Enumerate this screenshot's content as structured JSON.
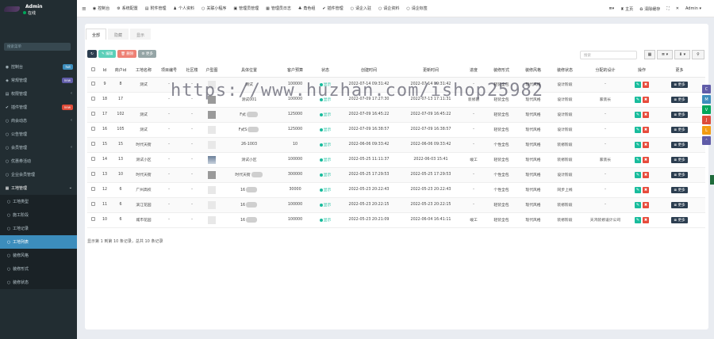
{
  "sidebar": {
    "user": "Admin",
    "status": "在线",
    "search_placeholder": "搜索菜单",
    "items": [
      {
        "icon": "◉",
        "label": "控制台",
        "badge": "hot",
        "badge_color": "#3c8dbc",
        "type": "top"
      },
      {
        "icon": "◈",
        "label": "常规管理",
        "badge": "new",
        "badge_color": "#605ca8",
        "type": "top"
      },
      {
        "icon": "▤",
        "label": "权限管理",
        "badge": "",
        "chev": "‹",
        "type": "top"
      },
      {
        "icon": "✔",
        "label": "插件管理",
        "badge": "new",
        "badge_color": "#dd4b39",
        "type": "top"
      },
      {
        "icon": "○",
        "label": "商会动态",
        "badge": "",
        "chev": "‹",
        "type": "top"
      },
      {
        "icon": "○",
        "label": "公告管理",
        "badge": "",
        "type": "top"
      },
      {
        "icon": "○",
        "label": "会员管理",
        "badge": "",
        "chev": "‹",
        "type": "top"
      },
      {
        "icon": "○",
        "label": "优惠券活动",
        "badge": "",
        "type": "top"
      },
      {
        "icon": "○",
        "label": "企业会员管理",
        "badge": "",
        "type": "top"
      },
      {
        "icon": "▦",
        "label": "工地管理",
        "badge": "",
        "chev": "⌄",
        "type": "open"
      },
      {
        "icon": "○",
        "label": "工地类型",
        "type": "sub"
      },
      {
        "icon": "○",
        "label": "施工阶段",
        "type": "sub"
      },
      {
        "icon": "○",
        "label": "工地记录",
        "type": "sub"
      },
      {
        "icon": "○",
        "label": "工地列表",
        "type": "active"
      },
      {
        "icon": "○",
        "label": "装修风格",
        "type": "sub"
      },
      {
        "icon": "○",
        "label": "装修形式",
        "type": "sub"
      },
      {
        "icon": "○",
        "label": "装修状态",
        "type": "sub"
      }
    ]
  },
  "topbar": {
    "menu_icon": "≡",
    "items": [
      {
        "icon": "◉",
        "label": "控制台"
      },
      {
        "icon": "⚙",
        "label": "系统配置"
      },
      {
        "icon": "▤",
        "label": "附件管理"
      },
      {
        "icon": "♟",
        "label": "个人资料"
      },
      {
        "icon": "○",
        "label": "关联小程序"
      },
      {
        "icon": "▣",
        "label": "管理员管理"
      },
      {
        "icon": "▦",
        "label": "管理员日志"
      },
      {
        "icon": "♣",
        "label": "角色组"
      },
      {
        "icon": "✔",
        "label": "插件管理"
      },
      {
        "icon": "○",
        "label": "请企入驻"
      },
      {
        "icon": "○",
        "label": "请企资料"
      },
      {
        "icon": "○",
        "label": "请企标签"
      }
    ],
    "right": [
      "≣▾",
      "♜ 主页",
      "♻ 清除缓存",
      "⛶",
      "✕",
      "Admin ▾"
    ]
  },
  "tabs": [
    "全部",
    "隐藏",
    "显示"
  ],
  "toolbar": {
    "refresh": "↻",
    "edit": "✎ 编辑",
    "delete": "🗑 删除",
    "more": "⚙ 更多"
  },
  "table_search_placeholder": "搜索",
  "table_tools": [
    "▦",
    "≣ ▾",
    "⬇ ▾",
    "⚲"
  ],
  "columns": [
    "",
    "Id",
    "商户id",
    "工地名称",
    "项目编号",
    "社区楼",
    "户型图",
    "具体位置",
    "客户预算",
    "状态",
    "创建时间",
    "更新时间",
    "进度",
    "装修形式",
    "装修风格",
    "装修状态",
    "分配的设计",
    "操作",
    "更多"
  ],
  "rows": [
    {
      "id": "9",
      "shop": "8",
      "name": "测试",
      "code": "-",
      "comm": "-",
      "pos": "测试",
      "budget": "100000",
      "status": "显示",
      "created": "2022-07-14 09:31:42",
      "updated": "2022-07-14 09:31:42",
      "prog": "-",
      "form": "轻装全包",
      "style": "现代风格",
      "state": "设计阶段",
      "design": "-"
    },
    {
      "id": "18",
      "shop": "17",
      "name": "",
      "code": "-",
      "comm": "-",
      "pos": "测试001",
      "budget": "100000",
      "status": "显示",
      "created": "2022-07-09 17:27:30",
      "updated": "2022-07-13 17:11:31",
      "prog": "装修前",
      "form": "轻装全包",
      "style": "现代风格",
      "state": "设计阶段",
      "design": "家装长"
    },
    {
      "id": "17",
      "shop": "102",
      "name": "测试",
      "code": "-",
      "comm": "-",
      "pos": "F式",
      "budget": "125000",
      "status": "显示",
      "created": "2022-07-09 16:45:22",
      "updated": "2022-07-09 16:45:22",
      "prog": "-",
      "form": "轻装全包",
      "style": "现代风格",
      "state": "设计阶段",
      "design": "-"
    },
    {
      "id": "16",
      "shop": "105",
      "name": "测试",
      "code": "-",
      "comm": "-",
      "pos": "F式S",
      "budget": "125000",
      "status": "显示",
      "created": "2022-07-09 16:38:57",
      "updated": "2022-07-09 16:38:57",
      "prog": "-",
      "form": "轻装全包",
      "style": "现代风格",
      "state": "设计阶段",
      "design": "-"
    },
    {
      "id": "15",
      "shop": "15",
      "name": "时代天街",
      "code": "-",
      "comm": "-",
      "pos": "26-1003",
      "budget": "10",
      "status": "显示",
      "created": "2022-06-06 09:33:42",
      "updated": "2022-06-06 09:33:42",
      "prog": "-",
      "form": "个性全包",
      "style": "现代风格",
      "state": "装修阶段",
      "design": "-"
    },
    {
      "id": "14",
      "shop": "13",
      "name": "测试小区",
      "code": "-",
      "comm": "-",
      "pos": "测试小区",
      "budget": "100000",
      "status": "显示",
      "created": "2022-05-25 11:11:37",
      "updated": "2022-06-03 15:41",
      "prog": "竣工",
      "form": "轻装全包",
      "style": "现代风格",
      "state": "装修阶段",
      "design": "家装长"
    },
    {
      "id": "13",
      "shop": "10",
      "name": "时代天街",
      "code": "-",
      "comm": "-",
      "pos": "时代天街",
      "budget": "300000",
      "status": "显示",
      "created": "2022-05-25 17:29:53",
      "updated": "2022-05-25 17:29:53",
      "prog": "-",
      "form": "个性全包",
      "style": "现代风格",
      "state": "设计阶段",
      "design": "-"
    },
    {
      "id": "12",
      "shop": "6",
      "name": "广州高校",
      "code": "-",
      "comm": "-",
      "pos": "16",
      "budget": "30000",
      "status": "显示",
      "created": "2022-05-23 20:22:43",
      "updated": "2022-05-23 20:22:43",
      "prog": "-",
      "form": "个性全包",
      "style": "现代风格",
      "state": "同步上线",
      "design": "-"
    },
    {
      "id": "11",
      "shop": "6",
      "name": "滨江花园",
      "code": "-",
      "comm": "-",
      "pos": "16",
      "budget": "100000",
      "status": "显示",
      "created": "2022-05-23 20:22:15",
      "updated": "2022-05-23 20:22:15",
      "prog": "-",
      "form": "轻装全包",
      "style": "现代风格",
      "state": "装修阶段",
      "design": "-"
    },
    {
      "id": "10",
      "shop": "6",
      "name": "城市花园",
      "code": "-",
      "comm": "-",
      "pos": "16",
      "budget": "100000",
      "status": "显示",
      "created": "2022-05-23 20:21:09",
      "updated": "2022-06-04 16:41:11",
      "prog": "竣工",
      "form": "轻装全包",
      "style": "现代风格",
      "state": "装修阶段",
      "design": "天鸿装修设计公司"
    }
  ],
  "footer": "显示第 1 到第 10 条记录，总共 10 条记录",
  "watermark": "https://www.huzhan.com/ishop25982",
  "more_label": "≣ 更多",
  "side_floats": [
    {
      "label": "C",
      "color": "#605ca8"
    },
    {
      "label": "M",
      "color": "#3c8dbc"
    },
    {
      "label": "V",
      "color": "#00a65a"
    },
    {
      "label": "J",
      "color": "#dd4b39"
    },
    {
      "label": "L",
      "color": "#f39c12"
    },
    {
      "label": "⌃",
      "color": "#605ca8"
    }
  ]
}
